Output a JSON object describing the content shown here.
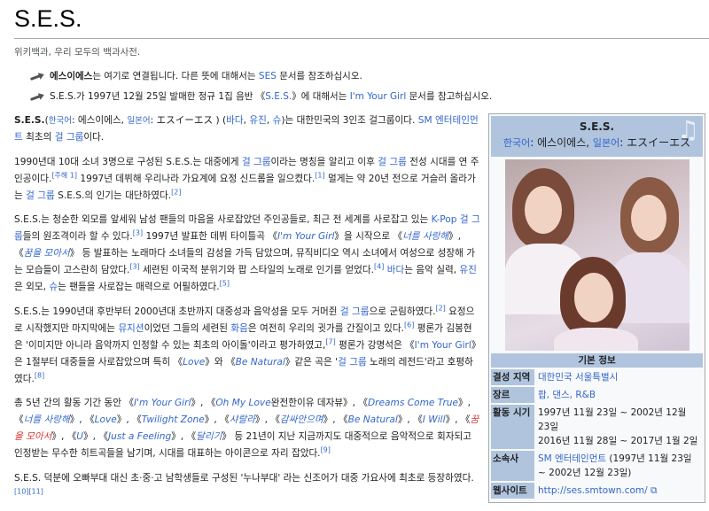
{
  "page": {
    "title": "S.E.S.",
    "tagline": "위키백과, 우리 모두의 백과사전."
  },
  "hatnotes": [
    [
      {
        "t": "에스이에스",
        "b": true
      },
      {
        "t": "는 여기로 연결됩니다. 다른 뜻에 대해서는 "
      },
      {
        "t": "SES",
        "link": true
      },
      {
        "t": " 문서를 참조하십시오."
      }
    ],
    [
      {
        "t": "S.E.S.가 1997년 12월 25일 발매한 정규 1집 음반 《"
      },
      {
        "t": "S.E.S.",
        "link": true
      },
      {
        "t": "》에 대해서는 "
      },
      {
        "t": "I'm Your Girl",
        "link": true
      },
      {
        "t": " 문서를 참고하십시오."
      }
    ]
  ],
  "paragraphs": [
    [
      {
        "t": "S.E.S.",
        "b": true
      },
      {
        "t": "("
      },
      {
        "t": "한국어",
        "link": true,
        "small": true
      },
      {
        "t": ": 에스이에스, "
      },
      {
        "t": "일본어",
        "link": true,
        "small": true
      },
      {
        "t": ": エスイーエス ) ("
      },
      {
        "t": "바다",
        "link": true
      },
      {
        "t": ", "
      },
      {
        "t": "유진",
        "link": true
      },
      {
        "t": ", "
      },
      {
        "t": "슈",
        "link": true
      },
      {
        "t": ")는 대한민국의 3인조 걸그룹이다. "
      },
      {
        "t": "SM 엔터테인먼트",
        "link": true
      },
      {
        "t": " 최초의 "
      },
      {
        "t": "걸 그룹",
        "link": true
      },
      {
        "t": "이다."
      }
    ],
    [
      {
        "t": "1990년대 10대 소녀 3명으로 구성된 S.E.S.는 대중에게 "
      },
      {
        "t": "걸 그룹",
        "link": true
      },
      {
        "t": "이라는 명칭을 알리고 이후 "
      },
      {
        "t": "걸 그룹",
        "link": true
      },
      {
        "t": " 전성 시대를 연 주인공이다."
      },
      {
        "t": "[주해 1]",
        "sup": true
      },
      {
        "t": " 1997년 데뷔해 우리나라 가요계에 요정 신드롬을 일으켰다."
      },
      {
        "t": "[1]",
        "sup": true
      },
      {
        "t": " 멀게는 약 20년 전으로 거슬러 올라가는 "
      },
      {
        "t": "걸 그룹",
        "link": true
      },
      {
        "t": " S.E.S.의 인기는 대단하였다."
      },
      {
        "t": "[2]",
        "sup": true
      }
    ],
    [
      {
        "t": "S.E.S.는 청순한 외모를 앞세워 남성 팬들의 마음을 사로잡았던 주인공들로, 최근 전 세계를 사로잡고 있는 "
      },
      {
        "t": "K-Pop",
        "link": true
      },
      {
        "t": " "
      },
      {
        "t": "걸 그룹",
        "link": true
      },
      {
        "t": "들의 원조격이라 할 수 있다."
      },
      {
        "t": "[3]",
        "sup": true
      },
      {
        "t": " 1997년 발표한 데뷔 타이틀곡 《"
      },
      {
        "t": "I'm Your Girl",
        "link": true,
        "i": true
      },
      {
        "t": "》을 시작으로 《"
      },
      {
        "t": "너를 사랑해",
        "link": true,
        "i": true
      },
      {
        "t": "》, 《"
      },
      {
        "t": "꿈을 모아서",
        "link": true,
        "i": true
      },
      {
        "t": "》 등 발표하는 노래마다 소녀들의 감성을 가득 담았으며, 뮤직비디오 역시 소녀에서 여성으로 성장해 가는 모습들이 고스란히 담았다."
      },
      {
        "t": "[3]",
        "sup": true
      },
      {
        "t": " 세련된 이국적 분위기와 팝 스타일의 노래로 인기를 얻었다."
      },
      {
        "t": "[4]",
        "sup": true
      },
      {
        "t": " "
      },
      {
        "t": "바다",
        "link": true
      },
      {
        "t": "는 음악 실력, "
      },
      {
        "t": "유진",
        "link": true
      },
      {
        "t": "은 외모, "
      },
      {
        "t": "슈",
        "link": true
      },
      {
        "t": "는 팬들을 사로잡는 매력으로 어필하였다."
      },
      {
        "t": "[5]",
        "sup": true
      }
    ],
    [
      {
        "t": "S.E.S.는 1990년대 후반부터 2000년대 초반까지 대중성과 음악성을 모두 거머쥔 "
      },
      {
        "t": "걸 그룹",
        "link": true
      },
      {
        "t": "으로 군림하였다."
      },
      {
        "t": "[2]",
        "sup": true
      },
      {
        "t": " 요정으로 시작했지만 마지막에는 "
      },
      {
        "t": "뮤지션",
        "link": true
      },
      {
        "t": "이었던 그들의 세련된 "
      },
      {
        "t": "화음",
        "link": true
      },
      {
        "t": "은 여전히 우리의 귓가를 간질이고 있다."
      },
      {
        "t": "[6]",
        "sup": true
      },
      {
        "t": " 평론가 김봉현은 '이미지만 아니라 음악까지 인정할 수 있는 최초의 아이돌'이라고 평가하였고,"
      },
      {
        "t": "[7]",
        "sup": true
      },
      {
        "t": " 평론가 강명석은 《"
      },
      {
        "t": "I'm Your Girl",
        "link": true
      },
      {
        "t": "》은 1절부터 대중들을 사로잡았으며 특히 《"
      },
      {
        "t": "Love",
        "link": true,
        "i": true
      },
      {
        "t": "》와 《"
      },
      {
        "t": "Be Natural",
        "link": true,
        "i": true
      },
      {
        "t": "》같은 곡은 '"
      },
      {
        "t": "걸 그룹",
        "link": true
      },
      {
        "t": " 노래의 레전드'라고 호평하였다."
      },
      {
        "t": "[8]",
        "sup": true
      }
    ],
    [
      {
        "t": "총 5년 간의 활동 기간 동안 《"
      },
      {
        "t": "I'm Your Girl",
        "link": true,
        "i": true
      },
      {
        "t": "》, 《"
      },
      {
        "t": "Oh My Love",
        "link": true,
        "i": true
      },
      {
        "t": "완전한이유 데자뷰》, 《"
      },
      {
        "t": "Dreams Come True",
        "link": true,
        "i": true
      },
      {
        "t": "》, 《"
      },
      {
        "t": "너를 사랑해",
        "link": true,
        "i": true
      },
      {
        "t": "》, 《"
      },
      {
        "t": "Love",
        "link": true,
        "i": true
      },
      {
        "t": "》, 《"
      },
      {
        "t": "Twilight Zone",
        "link": true,
        "i": true
      },
      {
        "t": "》, 《"
      },
      {
        "t": "샤랄라",
        "link": true,
        "i": true
      },
      {
        "t": "》, 《"
      },
      {
        "t": "감싸안으며",
        "link": true,
        "i": true
      },
      {
        "t": "》, 《"
      },
      {
        "t": "Be Natural",
        "link": true,
        "i": true
      },
      {
        "t": "》, 《"
      },
      {
        "t": "I Will",
        "link": true,
        "i": true
      },
      {
        "t": "》, 《"
      },
      {
        "t": "꿈을 모아서",
        "red": true,
        "i": true
      },
      {
        "t": "》, 《"
      },
      {
        "t": "U",
        "link": true,
        "i": true
      },
      {
        "t": "》, 《"
      },
      {
        "t": "Just a Feeling",
        "link": true,
        "i": true
      },
      {
        "t": "》, 《"
      },
      {
        "t": "달리기",
        "link": true,
        "i": true
      },
      {
        "t": "》 등 21년이 지난 지금까지도 대중적으로 음악적으로 회자되고 인정받는 무수한 히트곡들을 남기며, 시대를 대표하는 아이콘으로 자리 잡았다."
      },
      {
        "t": "[9]",
        "sup": true
      }
    ],
    [
      {
        "t": "S.E.S. 덕분에 오빠부대 대신 초·중·고 남학생들로 구성된 '누나부대' 라는 신조어가 대중 가요사에 최초로 등장하였다."
      },
      {
        "t": "[10]",
        "sup": true
      },
      {
        "t": "[11]",
        "sup": true
      }
    ]
  ],
  "infobox": {
    "name": "S.E.S.",
    "ko_label": "한국어",
    "ko_value": "에스이에스",
    "ja_label": "일본어",
    "ja_value": "エスイーエス",
    "section": "기본 정보",
    "rows": [
      {
        "label": "결성 지역",
        "value": "대한민국 서울특별시",
        "link": true
      },
      {
        "label": "장르",
        "value": "팝, 댄스, R&B",
        "link": true
      },
      {
        "label": "활동 시기",
        "value": "1997년 11월 23일 ~ 2002년 12월 23일",
        "value2": "2016년 11월 28일 ~ 2017년 1월 2일"
      },
      {
        "label": "소속사",
        "value": "SM 엔터테인먼트",
        "link": true,
        "extra": " (1997년 11월 23일 ~ 2002년 12월 23일)"
      },
      {
        "label": "웹사이트",
        "value": "http://ses.smtown.com/",
        "link": true,
        "ext": true
      }
    ]
  },
  "colors": {
    "link": "#3366cc",
    "infobox_header": "#b0c4de",
    "redlink": "#dd3333"
  }
}
